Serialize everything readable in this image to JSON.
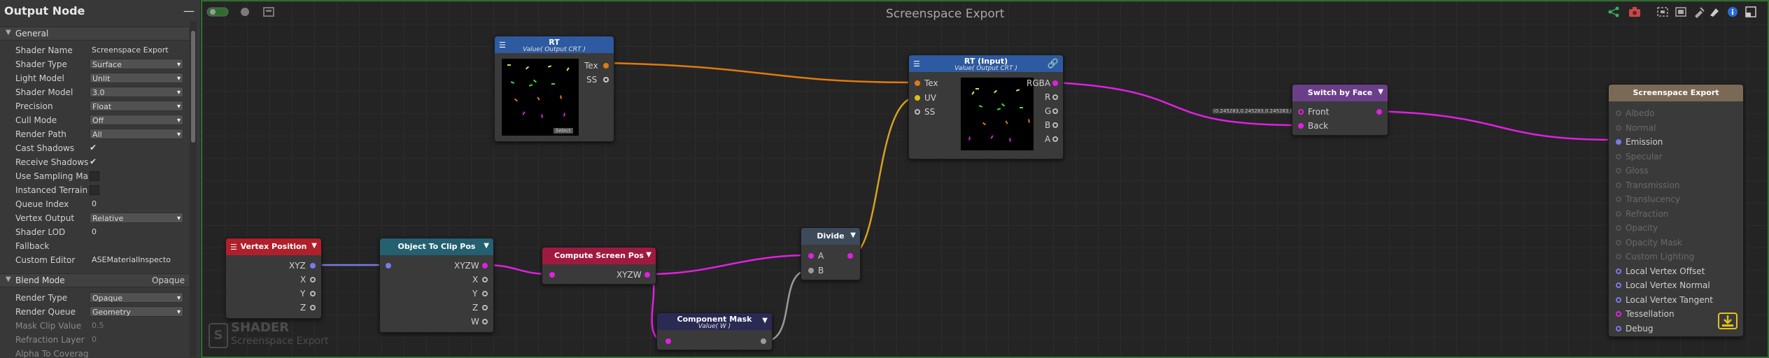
{
  "inspector": {
    "title": "Output Node",
    "minimize": "—",
    "general_section": "General",
    "blend_section": "Blend Mode",
    "blend_value": "Opaque",
    "rows": [
      {
        "label": "Shader Name",
        "value": "Screenspace Export",
        "kind": "plain"
      },
      {
        "label": "Shader Type",
        "value": "Surface",
        "kind": "dropdown"
      },
      {
        "label": "Light Model",
        "value": "Unlit",
        "kind": "dropdown"
      },
      {
        "label": "Shader Model",
        "value": "3.0",
        "kind": "dropdown"
      },
      {
        "label": "Precision",
        "value": "Float",
        "kind": "dropdown"
      },
      {
        "label": "Cull Mode",
        "value": "Off",
        "kind": "dropdown"
      },
      {
        "label": "Render Path",
        "value": "All",
        "kind": "dropdown"
      },
      {
        "label": "Cast Shadows",
        "value": "✔",
        "kind": "check"
      },
      {
        "label": "Receive Shadows",
        "value": "✔",
        "kind": "check"
      },
      {
        "label": "Use Sampling Mac",
        "value": "",
        "kind": "box"
      },
      {
        "label": "Instanced Terrain",
        "value": "",
        "kind": "box"
      },
      {
        "label": "Queue Index",
        "value": "0",
        "kind": "plain"
      },
      {
        "label": "Vertex Output",
        "value": "Relative",
        "kind": "dropdown"
      },
      {
        "label": "Shader LOD",
        "value": "0",
        "kind": "plain"
      },
      {
        "label": "Fallback",
        "value": "",
        "kind": "plain"
      },
      {
        "label": "Custom Editor",
        "value": "ASEMaterialInspecto",
        "kind": "plain"
      }
    ],
    "blend_rows": [
      {
        "label": "Render Type",
        "value": "Opaque",
        "kind": "dropdown"
      },
      {
        "label": "Render Queue",
        "value": "Geometry",
        "kind": "dropdown"
      },
      {
        "label": "Mask Clip Value",
        "value": "0.5",
        "kind": "dim"
      },
      {
        "label": "Refraction Layer",
        "value": "0",
        "kind": "dim"
      },
      {
        "label": "Alpha To Coverage",
        "value": "",
        "kind": "dim"
      }
    ]
  },
  "canvas": {
    "title": "Screenspace Export",
    "watermark_title": "SHADER",
    "watermark_sub": "Screenspace Export",
    "watermark_icon": "S"
  },
  "nodes": {
    "rt": {
      "title": "RT",
      "subtitle": "Value( Output CRT )",
      "ports": [
        "Tex",
        "SS"
      ],
      "select": "Select"
    },
    "rt_input": {
      "title": "RT (Input)",
      "subtitle": "Value( Output CRT )",
      "in_ports": [
        "Tex",
        "UV",
        "SS"
      ],
      "out_ports": [
        "RGBA",
        "R",
        "G",
        "B",
        "A"
      ]
    },
    "switch": {
      "title": "Switch by Face",
      "ports": [
        "Front",
        "Back"
      ]
    },
    "output": {
      "title": "Screenspace Export",
      "ports": [
        "Albedo",
        "Normal",
        "Emission",
        "Specular",
        "Gloss",
        "Transmission",
        "Translucency",
        "Refraction",
        "Opacity",
        "Opacity Mask",
        "Custom Lighting",
        "Local Vertex Offset",
        "Local Vertex Normal",
        "Local Vertex Tangent",
        "Tessellation",
        "Debug"
      ]
    },
    "vertex": {
      "title": "Vertex Position",
      "ports": [
        "XYZ",
        "X",
        "Y",
        "Z"
      ]
    },
    "clip": {
      "title": "Object To Clip Pos",
      "ports": [
        "XYZW",
        "X",
        "Y",
        "Z",
        "W"
      ]
    },
    "screen": {
      "title": "Compute Screen Pos",
      "ports": [
        "XYZW"
      ]
    },
    "mask": {
      "title": "Component Mask",
      "subtitle": "Value( W )"
    },
    "divide": {
      "title": "Divide",
      "ports": [
        "A",
        "B"
      ]
    }
  },
  "wire_label": "(0.245283,0.245283,0.245283,0)",
  "colors": {
    "rt_header": "#2d5aa0",
    "switch_header": "#6b3e8a",
    "output_header": "#7a6a55",
    "vertex_header": "#b0202a",
    "clip_header": "#246070",
    "screen_header": "#a01a40",
    "mask_header": "#2a2a55",
    "divide_header": "#3d4a5a",
    "wire_magenta": "#e020e0",
    "wire_orange": "#e07a10",
    "wire_yellow": "#d8a020",
    "wire_blue": "#7a7ae8",
    "wire_gray": "#9a9a9a"
  }
}
